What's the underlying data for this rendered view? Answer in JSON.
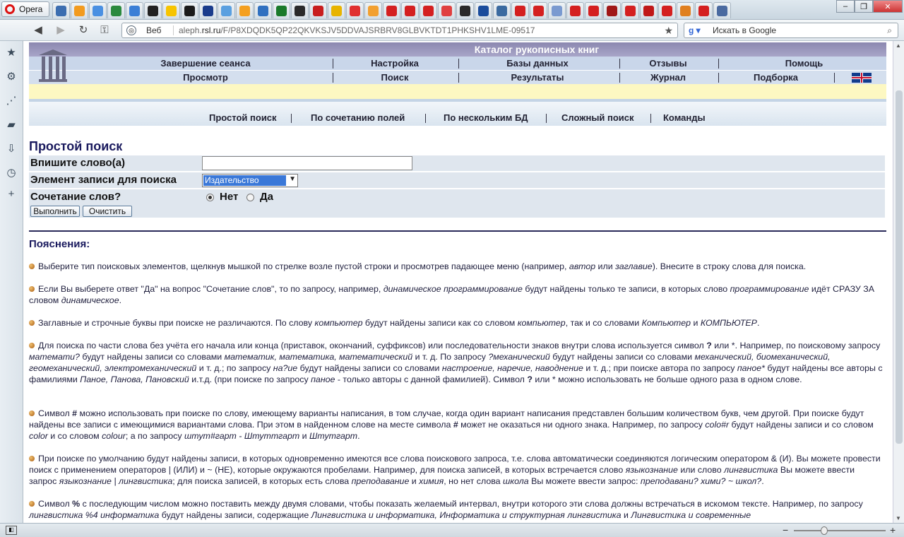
{
  "browser": {
    "name": "Opera",
    "address": {
      "web_label": "Веб",
      "domain_part": "aleph.",
      "domain_bold": "rsl.ru",
      "path": "/F/P8XDQDK5QP22QKVKSJV5DDVAJSRBRV8GLBVKTDT1PHKSHV1LME-09517"
    },
    "search_placeholder": "Искать в Google",
    "tab_colors": [
      "#3b6db0",
      "#f29b1f",
      "#4a90e2",
      "#2b8a3e",
      "#3b7fd6",
      "#222222",
      "#f7c400",
      "#1b1b1b",
      "#1a3c8c",
      "#5aa0e0",
      "#f4a020",
      "#3070c0",
      "#1a7a2a",
      "#2a2a2a",
      "#c81e1e",
      "#e8b400",
      "#e03030",
      "#f2a030",
      "#d42020",
      "#d42020",
      "#d42020",
      "#e04040",
      "#2a2a2a",
      "#1a4c9c",
      "#3a6aa0",
      "#d42020",
      "#d42020",
      "#7a9ad0",
      "#d42020",
      "#d42020",
      "#a01818",
      "#d42020",
      "#c01818",
      "#d42020",
      "#e08020",
      "#d42020",
      "#4a6aa0"
    ]
  },
  "header": {
    "catalog_title": "Каталог рукописных книг",
    "row1": [
      "Завершение сеанса",
      "Настройка",
      "Базы данных",
      "Отзывы",
      "Помощь"
    ],
    "row2": [
      "Просмотр",
      "Поиск",
      "Результаты",
      "Журнал",
      "Подборка"
    ]
  },
  "subnav": [
    "Простой поиск",
    "По сочетанию полей",
    "По нескольким БД",
    "Сложный поиск",
    "Команды"
  ],
  "form": {
    "title": "Простой поиск",
    "field1_label": "Впишите слово(а)",
    "field1_value": "",
    "field2_label": "Элемент записи для поиска",
    "field2_value": "Издательство",
    "field3_label": "Сочетание слов?",
    "radio_no": "Нет",
    "radio_yes": "Да",
    "radio_selected": "Нет",
    "submit": "Выполнить",
    "clear": "Очистить"
  },
  "explanations_title": "Пояснения:",
  "paragraphs": [
    [
      [
        "t",
        "Выберите тип поисковых элементов, щелкнув мышкой по стрелке возле пустой строки и просмотрев падающее меню (например, "
      ],
      [
        "i",
        "автор"
      ],
      [
        "t",
        " или "
      ],
      [
        "i",
        "заглавие"
      ],
      [
        "t",
        "). Внесите в строку слова для поиска."
      ]
    ],
    [
      [
        "t",
        "Если Вы выберете ответ \"Да\" на вопрос \"Сочетание слов\", то по запросу, например, "
      ],
      [
        "i",
        "динамическое программирование"
      ],
      [
        "t",
        " будут найдены только те записи, в которых слово "
      ],
      [
        "i",
        "программирование"
      ],
      [
        "t",
        " идёт СРАЗУ ЗА словом "
      ],
      [
        "i",
        "динамическое"
      ],
      [
        "t",
        "."
      ]
    ],
    [
      [
        "t",
        "Заглавные и строчные буквы при поиске не различаются. По слову "
      ],
      [
        "i",
        "компьютер"
      ],
      [
        "t",
        " будут найдены записи как со словом "
      ],
      [
        "i",
        "компьютер"
      ],
      [
        "t",
        ", так и со словами "
      ],
      [
        "i",
        "Компьютер"
      ],
      [
        "t",
        " и "
      ],
      [
        "i",
        "КОМПЬЮТЕР"
      ],
      [
        "t",
        "."
      ]
    ],
    [
      [
        "t",
        "Для поиска по части слова без учёта его начала или конца (приставок, окончаний, суффиксов) или последовательности знаков внутри слова используется символ "
      ],
      [
        "b",
        "?"
      ],
      [
        "t",
        " или *. Например, по поисковому запросу "
      ],
      [
        "i",
        "математи?"
      ],
      [
        "t",
        " будут найдены записи со словами "
      ],
      [
        "i",
        "математик, математика, математический"
      ],
      [
        "t",
        " и т. д. По запросу "
      ],
      [
        "i",
        "?механический"
      ],
      [
        "t",
        " будут найдены записи со словами "
      ],
      [
        "i",
        "механический, биомеханический, геомеханический, электромеханический"
      ],
      [
        "t",
        " и т. д.; по запросу "
      ],
      [
        "i",
        "на?ие"
      ],
      [
        "t",
        " будут найдены записи со словами "
      ],
      [
        "i",
        "настроение, наречие, наводнение"
      ],
      [
        "t",
        " и т. д.; при поиске автора по запросу "
      ],
      [
        "i",
        "паное*"
      ],
      [
        "t",
        " будут найдены все авторы с фамилиями "
      ],
      [
        "i",
        "Паное, Панова, Пановский"
      ],
      [
        "t",
        " и.т.д. (при поиске по запросу "
      ],
      [
        "i",
        "паное"
      ],
      [
        "t",
        " - только авторы с данной фамилией). Символ "
      ],
      [
        "b",
        "?"
      ],
      [
        "t",
        " или * можно использовать не больше одного раза в одном слове."
      ]
    ],
    [
      [
        "t",
        "Символ "
      ],
      [
        "b",
        "#"
      ],
      [
        "t",
        " можно использовать при поиске по слову, имеющему варианты написания, в том случае, когда один вариант написания представлен большим количеством букв, чем другой. При поиске будут найдены все записи с имеющимися вариантами слова. При этом в найденном слове на месте символа "
      ],
      [
        "b",
        "#"
      ],
      [
        "t",
        " может не оказаться ни одного знака. Например, по запросу "
      ],
      [
        "i",
        "colo#r"
      ],
      [
        "t",
        " будут найдены записи и со словом "
      ],
      [
        "i",
        "color"
      ],
      [
        "t",
        " и со словом "
      ],
      [
        "i",
        "colour"
      ],
      [
        "t",
        "; а по запросу "
      ],
      [
        "i",
        "штут#гарт - Штуттгарт"
      ],
      [
        "t",
        " и "
      ],
      [
        "i",
        "Штутгарт"
      ],
      [
        "t",
        "."
      ]
    ],
    [
      [
        "t",
        "При поиске по умолчанию будут найдены записи, в которых одновременно имеются все слова поискового запроса, т.е. слова автоматически соединяются логическим оператором & (И). Вы можете провести поиск с применением операторов | (ИЛИ) и ~ (НЕ), которые окружаются пробелами. Например, для поиска записей, в которых встречается слово "
      ],
      [
        "i",
        "языкознание"
      ],
      [
        "t",
        " или слово "
      ],
      [
        "i",
        "лингвистика"
      ],
      [
        "t",
        " Вы можете ввести запрос "
      ],
      [
        "i",
        "языкознание | лингвистика"
      ],
      [
        "t",
        "; для поиска записей, в которых есть слова "
      ],
      [
        "i",
        "преподавание"
      ],
      [
        "t",
        " и "
      ],
      [
        "i",
        "химия"
      ],
      [
        "t",
        ", но нет слова "
      ],
      [
        "i",
        "школа"
      ],
      [
        "t",
        " Вы можете ввести запрос: "
      ],
      [
        "i",
        "преподавани? хими? ~ школ?"
      ],
      [
        "t",
        "."
      ]
    ],
    [
      [
        "t",
        "Символ "
      ],
      [
        "b",
        "%"
      ],
      [
        "t",
        " с последующим числом можно поставить между двумя словами, чтобы показать желаемый интервал, внутри которого эти слова должны встречаться в искомом тексте. Например, по запросу "
      ],
      [
        "i",
        "лингвистика %4 информатика"
      ],
      [
        "t",
        " будут найдены записи, содержащие "
      ],
      [
        "i",
        "Лингвистика и информатика, Информатика и структурная лингвистика"
      ],
      [
        "t",
        " и "
      ],
      [
        "i",
        "Лингвистика и современные"
      ]
    ]
  ]
}
